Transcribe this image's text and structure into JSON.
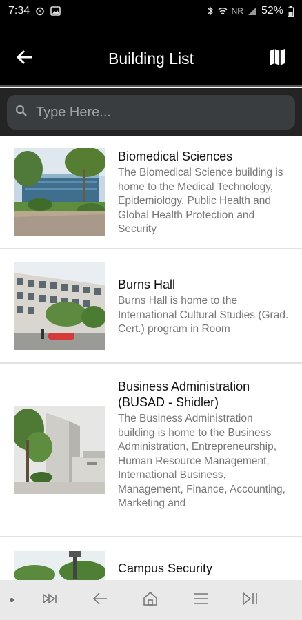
{
  "status_bar": {
    "time": "7:34",
    "battery": "52%",
    "network_label": "NR",
    "icons": [
      "alarm-icon",
      "image-icon",
      "bluetooth-icon",
      "wifi-icon",
      "signal-icon",
      "battery-icon"
    ]
  },
  "app_bar": {
    "title": "Building List",
    "back_icon": "arrow-left-icon",
    "map_icon": "map-icon"
  },
  "search": {
    "placeholder": "Type Here...",
    "value": ""
  },
  "buildings": [
    {
      "title": "Biomedical Sciences",
      "description": "The Biomedical Science building is home to the Medical Technology, Epidemiology, Public Health and Global Health Protection and Security"
    },
    {
      "title": "Burns Hall",
      "description": "Burns Hall is home to the International Cultural Studies (Grad. Cert.) program in Room"
    },
    {
      "title": "Business Administration (BUSAD - Shidler)",
      "description": "The Business Administration building is home to the Business Administration, Entrepreneurship, Human Resource Management, International Business, Management, Finance, Accounting, Marketing and"
    },
    {
      "title": "Campus Security",
      "description": ""
    }
  ],
  "bottom_nav": {
    "icons": [
      "dot-icon",
      "fast-forward-icon",
      "back-arrow-icon",
      "home-icon",
      "menu-icon",
      "play-pause-icon"
    ]
  },
  "colors": {
    "app_bar_bg": "#000000",
    "search_bg": "#242424",
    "search_box_bg": "#3a3d40",
    "bottom_nav_bg": "#e9e9e9"
  }
}
